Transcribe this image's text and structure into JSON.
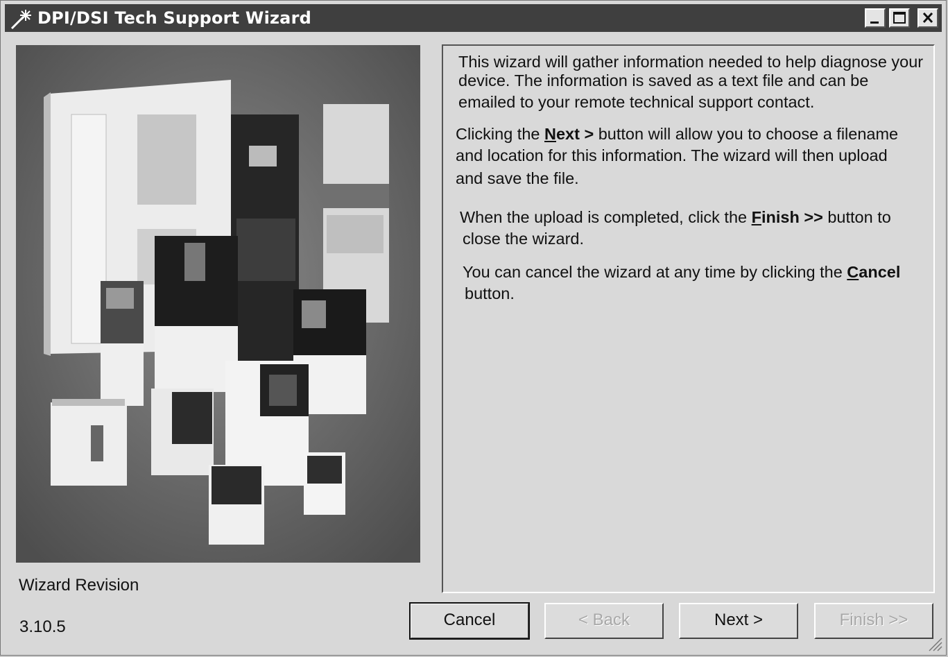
{
  "window": {
    "title": "DPI/DSI Tech Support Wizard",
    "icon": "wizard-wand-icon",
    "controls": [
      "minimize-icon",
      "maximize-icon",
      "close-icon"
    ]
  },
  "description": {
    "p1": {
      "line1": "This wizard will gather information needed to help diagnose your",
      "line2": "device. The information is saved as a text file and can be",
      "line3": "emailed to your remote technical support contact."
    },
    "p2": {
      "line1_a": "Clicking the ",
      "line1_key_u": "N",
      "line1_key_rest": "ext >",
      "line1_b": " button will allow you to choose a filename",
      "line2": "and location for this information.  The wizard will then upload",
      "line3": "and save the file."
    },
    "p3": {
      "line1_a": "When the upload is completed, click the ",
      "line1_key_u": "F",
      "line1_key_rest": "inish >>",
      "line1_b": " button to",
      "line2": "close the wizard."
    },
    "p4": {
      "line1_a": "You can cancel the wizard at any time by clicking the ",
      "line1_key_u": "C",
      "line1_key_rest": "ancel",
      "line2": "button."
    }
  },
  "revision": {
    "label": "Wizard Revision",
    "value": "3.10.5"
  },
  "buttons": {
    "cancel": "Cancel",
    "back": "< Back",
    "next": "Next >",
    "finish": "Finish >>"
  }
}
